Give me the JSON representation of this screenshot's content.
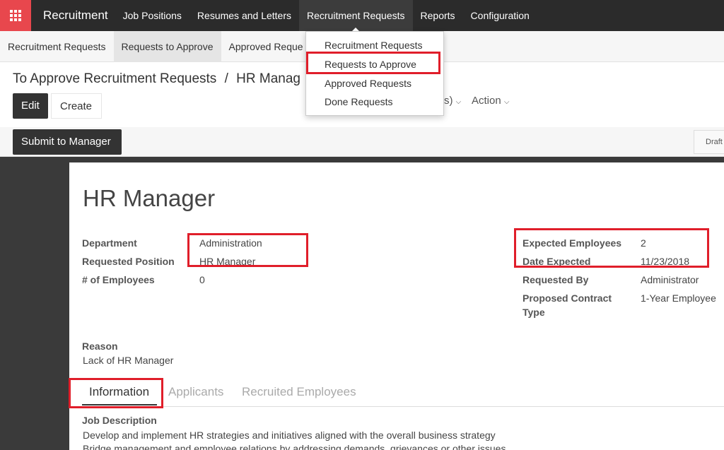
{
  "navbar": {
    "brand": "Recruitment",
    "items": [
      "Job Positions",
      "Resumes and Letters",
      "Recruitment Requests",
      "Reports",
      "Configuration"
    ]
  },
  "subbar": {
    "items": [
      "Recruitment Requests",
      "Requests to Approve",
      "Approved Reque"
    ]
  },
  "dropdown": {
    "items": [
      "Recruitment Requests",
      "Requests to Approve",
      "Approved Requests",
      "Done Requests"
    ]
  },
  "breadcrumb": {
    "parent": "To Approve Recruitment Requests",
    "separator": "/",
    "current": "HR Manag"
  },
  "control_panel": {
    "edit": "Edit",
    "create": "Create",
    "partial_filter": "s)",
    "action": "Action"
  },
  "statusbar": {
    "submit": "Submit to Manager",
    "draft": "Draft"
  },
  "form": {
    "title": "HR Manager",
    "left": [
      {
        "label": "Department",
        "value": "Administration"
      },
      {
        "label": "Requested Position",
        "value": "HR Manager"
      },
      {
        "label": "# of Employees",
        "value": "0"
      }
    ],
    "right": [
      {
        "label": "Expected Employees",
        "value": "2"
      },
      {
        "label": "Date Expected",
        "value": "11/23/2018"
      },
      {
        "label": "Requested By",
        "value": "Administrator"
      },
      {
        "label_line1": "Proposed Contract",
        "label_line2": "Type",
        "value": "1-Year Employee"
      }
    ],
    "reason_label": "Reason",
    "reason_value": "Lack of HR Manager",
    "tabs": [
      "Information",
      "Applicants",
      "Recruited Employees"
    ],
    "job_description_label": "Job Description",
    "job_description_lines": [
      "Develop and implement HR strategies and initiatives aligned with the overall business strategy",
      "Bridge management and employee relations by addressing demands, grievances or other issues"
    ]
  },
  "colors": {
    "navbar_bg": "#2b2b2b",
    "apps_button": "#e8474d",
    "highlight_box": "#e01e2a"
  }
}
